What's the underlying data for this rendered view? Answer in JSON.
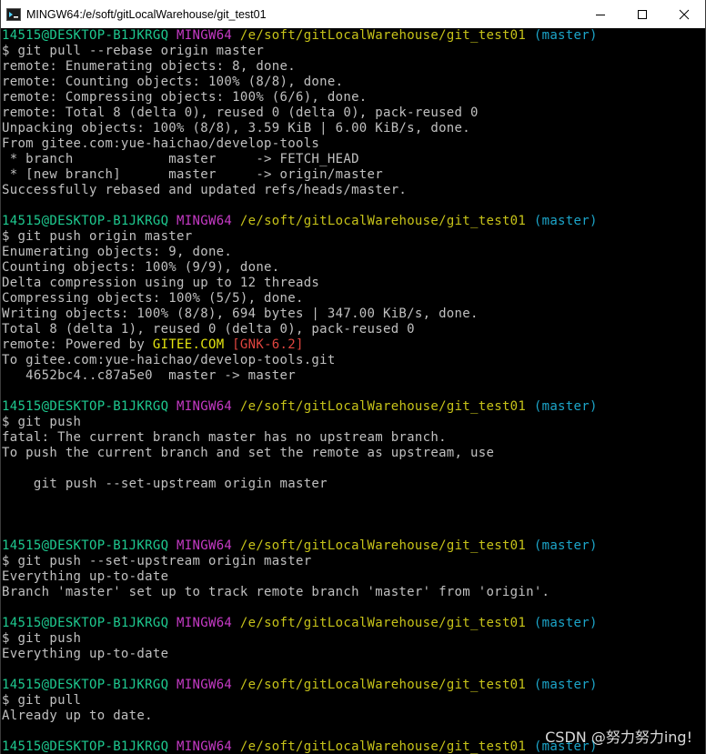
{
  "window": {
    "title": "MINGW64:/e/soft/gitLocalWarehouse/git_test01",
    "controls": {
      "minimize": "minimize-icon",
      "maximize": "maximize-icon",
      "close": "close-icon"
    }
  },
  "colors": {
    "user_host": "#1ec98f",
    "shell": "#c53ac5",
    "path": "#c7c319",
    "branch": "#1ca5c9",
    "text": "#c0c0c0",
    "highlight_yellow": "#e5e510",
    "highlight_red": "#e0453f"
  },
  "prompt": {
    "user_host": "14515@DESKTOP-B1JKRGQ",
    "shell": "MINGW64",
    "path": "/e/soft/gitLocalWarehouse/git_test01",
    "branch": "(master)"
  },
  "blocks": [
    {
      "command": "$ git pull --rebase origin master",
      "output": [
        "remote: Enumerating objects: 8, done.",
        "remote: Counting objects: 100% (8/8), done.",
        "remote: Compressing objects: 100% (6/6), done.",
        "remote: Total 8 (delta 0), reused 0 (delta 0), pack-reused 0",
        "Unpacking objects: 100% (8/8), 3.59 KiB | 6.00 KiB/s, done.",
        "From gitee.com:yue-haichao/develop-tools",
        " * branch            master     -> FETCH_HEAD",
        " * [new branch]      master     -> origin/master",
        "Successfully rebased and updated refs/heads/master.",
        ""
      ]
    },
    {
      "command": "$ git push origin master",
      "output": [
        "Enumerating objects: 9, done.",
        "Counting objects: 100% (9/9), done.",
        "Delta compression using up to 12 threads",
        "Compressing objects: 100% (5/5), done.",
        "Writing objects: 100% (8/8), 694 bytes | 347.00 KiB/s, done.",
        "Total 8 (delta 1), reused 0 (delta 0), pack-reused 0"
      ],
      "remote_line": {
        "prefix": "remote: Powered by ",
        "site": "GITEE.COM",
        "space": " ",
        "tag": "[GNK-6.2]"
      },
      "output_after": [
        "To gitee.com:yue-haichao/develop-tools.git",
        "   4652bc4..c87a5e0  master -> master",
        ""
      ]
    },
    {
      "command": "$ git push",
      "output": [
        "fatal: The current branch master has no upstream branch.",
        "To push the current branch and set the remote as upstream, use",
        "",
        "    git push --set-upstream origin master",
        "",
        "",
        ""
      ]
    },
    {
      "command": "$ git push --set-upstream origin master",
      "output": [
        "Everything up-to-date",
        "Branch 'master' set up to track remote branch 'master' from 'origin'.",
        ""
      ]
    },
    {
      "command": "$ git push",
      "output": [
        "Everything up-to-date",
        ""
      ]
    },
    {
      "command": "$ git pull",
      "output": [
        "Already up to date.",
        ""
      ]
    }
  ],
  "final_prompt_char": "$",
  "watermark": "CSDN @努力努力ing!"
}
